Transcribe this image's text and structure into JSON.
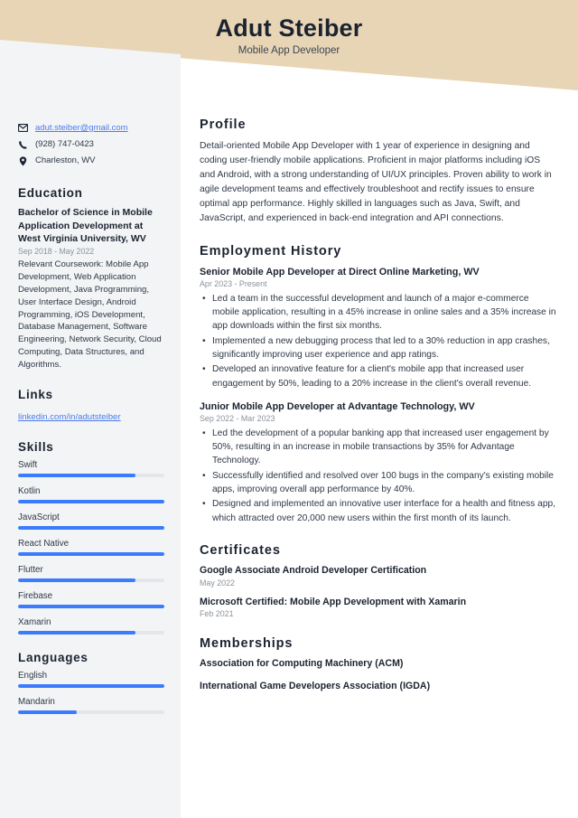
{
  "theme": {
    "header_bg": "#e8d5b5",
    "sidebar_bg": "#f2f4f6",
    "accent_blue": "#3b7bfd",
    "link_blue": "#4b7bec",
    "heading_color": "#1b2330",
    "muted_color": "#8b929c",
    "bar_track": "#e4e7ea"
  },
  "header": {
    "name": "Adut Steiber",
    "job_title": "Mobile App Developer"
  },
  "sidebar": {
    "contact": [
      {
        "icon": "envelope-icon",
        "text": "adut.steiber@gmail.com",
        "is_link": true
      },
      {
        "icon": "phone-icon",
        "text": "(928) 747-0423",
        "is_link": false
      },
      {
        "icon": "location-pin-icon",
        "text": "Charleston, WV",
        "is_link": false
      }
    ],
    "education": {
      "heading": "Education",
      "degree": "Bachelor of Science in Mobile Application Development at West Virginia University, WV",
      "date": "Sep 2018 - May 2022",
      "description": "Relevant Coursework: Mobile App Development, Web Application Development, Java Programming, User Interface Design, Android Programming, iOS Development, Database Management, Software Engineering, Network Security, Cloud Computing, Data Structures, and Algorithms."
    },
    "links": {
      "heading": "Links",
      "items": [
        {
          "label": "linkedin.com/in/adutsteiber"
        }
      ]
    },
    "skills": {
      "heading": "Skills",
      "items": [
        {
          "label": "Swift",
          "level": 80
        },
        {
          "label": "Kotlin",
          "level": 100
        },
        {
          "label": "JavaScript",
          "level": 100
        },
        {
          "label": "React Native",
          "level": 100
        },
        {
          "label": "Flutter",
          "level": 80
        },
        {
          "label": "Firebase",
          "level": 100
        },
        {
          "label": "Xamarin",
          "level": 80
        }
      ]
    },
    "languages": {
      "heading": "Languages",
      "items": [
        {
          "label": "English",
          "level": 100
        },
        {
          "label": "Mandarin",
          "level": 40
        }
      ]
    }
  },
  "main": {
    "profile": {
      "heading": "Profile",
      "text": "Detail-oriented Mobile App Developer with 1 year of experience in designing and coding user-friendly mobile applications. Proficient in major platforms including iOS and Android, with a strong understanding of UI/UX principles. Proven ability to work in agile development teams and effectively troubleshoot and rectify issues to ensure optimal app performance. Highly skilled in languages such as Java, Swift, and JavaScript, and experienced in back-end integration and API connections."
    },
    "employment": {
      "heading": "Employment History",
      "jobs": [
        {
          "title": "Senior Mobile App Developer at Direct Online Marketing, WV",
          "date": "Apr 2023 - Present",
          "bullets": [
            "Led a team in the successful development and launch of a major e-commerce mobile application, resulting in a 45% increase in online sales and a 35% increase in app downloads within the first six months.",
            "Implemented a new debugging process that led to a 30% reduction in app crashes, significantly improving user experience and app ratings.",
            "Developed an innovative feature for a client's mobile app that increased user engagement by 50%, leading to a 20% increase in the client's overall revenue."
          ]
        },
        {
          "title": "Junior Mobile App Developer at Advantage Technology, WV",
          "date": "Sep 2022 - Mar 2023",
          "bullets": [
            "Led the development of a popular banking app that increased user engagement by 50%, resulting in an increase in mobile transactions by 35% for Advantage Technology.",
            "Successfully identified and resolved over 100 bugs in the company's existing mobile apps, improving overall app performance by 40%.",
            "Designed and implemented an innovative user interface for a health and fitness app, which attracted over 20,000 new users within the first month of its launch."
          ]
        }
      ]
    },
    "certificates": {
      "heading": "Certificates",
      "items": [
        {
          "title": "Google Associate Android Developer Certification",
          "date": "May 2022"
        },
        {
          "title": "Microsoft Certified: Mobile App Development with Xamarin",
          "date": "Feb 2021"
        }
      ]
    },
    "memberships": {
      "heading": "Memberships",
      "items": [
        {
          "label": "Association for Computing Machinery (ACM)"
        },
        {
          "label": "International Game Developers Association (IGDA)"
        }
      ]
    }
  }
}
